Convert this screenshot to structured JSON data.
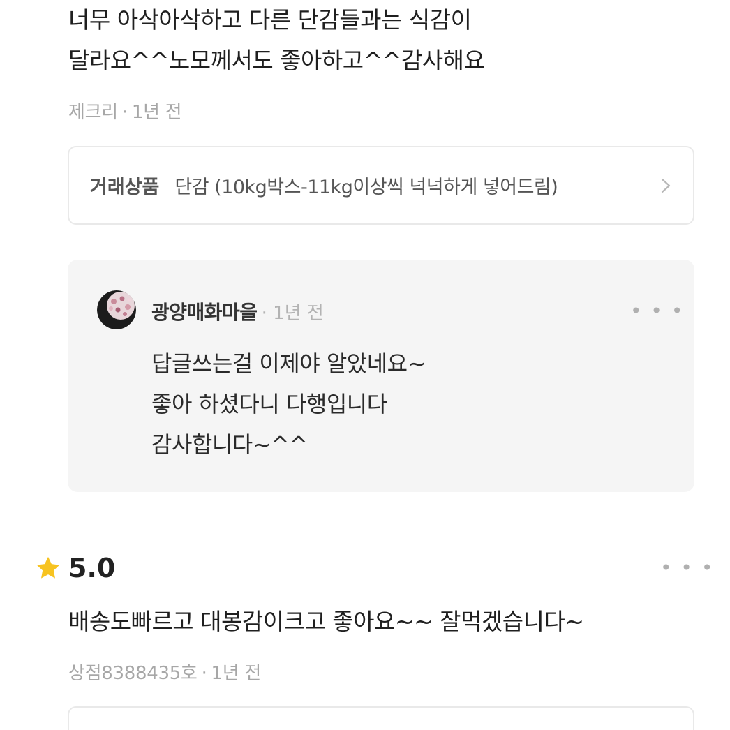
{
  "review1": {
    "text_line1": "너무 아삭아삭하고 다른 단감들과는 식감이",
    "text_line2": "달라요^^노모께서도 좋아하고^^감사해요",
    "author": "제크리",
    "separator": "·",
    "time": "1년 전"
  },
  "product": {
    "label": "거래상품",
    "name": "단감 (10kg박스-11kg이상씩 넉넉하게 넣어드림)",
    "chevron_icon": "chevron-right-icon"
  },
  "reply": {
    "seller_name": "광양매화마을",
    "separator": "·",
    "time": "1년 전",
    "more_icon": "more-dots-icon",
    "line1": "답글쓰는걸 이제야 알았네요~",
    "line2": "좋아 하셨다니 다행입니다",
    "line3": "감사합니다~^^"
  },
  "review2": {
    "star_icon": "star-icon",
    "rating": "5.0",
    "more_icon": "more-dots-icon",
    "text": "배송도빠르고 대봉감이크고 좋아요~~ 잘먹겠습니다~",
    "author": "상점8388435호",
    "separator": "·",
    "time": "1년 전"
  },
  "colors": {
    "star": "#f7c320",
    "reply_bg": "#f5f5f5",
    "meta_text": "#a7a7a7"
  }
}
